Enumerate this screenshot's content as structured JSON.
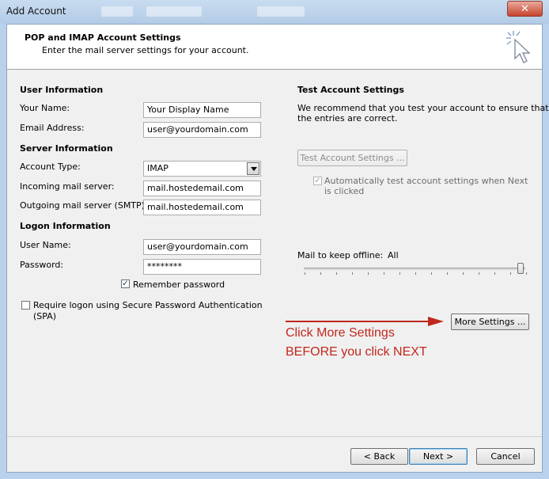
{
  "window": {
    "title": "Add Account",
    "close_label": "✕"
  },
  "header": {
    "title": "POP and IMAP Account Settings",
    "subtitle": "Enter the mail server settings for your account."
  },
  "user_info": {
    "heading": "User Information",
    "name_label": "Your Name:",
    "name_value": "Your Display Name",
    "email_label": "Email Address:",
    "email_value": "user@yourdomain.com"
  },
  "server_info": {
    "heading": "Server Information",
    "account_type_label": "Account Type:",
    "account_type_value": "IMAP",
    "incoming_label": "Incoming mail server:",
    "incoming_value": "mail.hostedemail.com",
    "outgoing_label": "Outgoing mail server (SMTP):",
    "outgoing_value": "mail.hostedemail.com"
  },
  "logon_info": {
    "heading": "Logon Information",
    "username_label": "User Name:",
    "username_value": "user@yourdomain.com",
    "password_label": "Password:",
    "password_value": "********",
    "remember_label": "Remember password",
    "remember_checked": true,
    "spa_label_line1": "Require logon using Secure Password Authentication",
    "spa_label_line2": "(SPA)",
    "spa_checked": false
  },
  "test_settings": {
    "heading": "Test Account Settings",
    "description_line1": "We recommend that you test your account to ensure that",
    "description_line2": "the entries are correct.",
    "test_button": "Test Account Settings ...",
    "auto_test_line1": "Automatically test account settings when Next",
    "auto_test_line2": "is clicked",
    "auto_test_checked": true
  },
  "offline": {
    "label": "Mail to keep offline:",
    "value": "All",
    "slider_fraction": 1.0
  },
  "more_settings_button": "More Settings ...",
  "annotation": {
    "line1": "Click More Settings",
    "line2": "BEFORE you click NEXT",
    "color": "#c0271d"
  },
  "footer": {
    "back": "< Back",
    "next": "Next >",
    "cancel": "Cancel"
  }
}
